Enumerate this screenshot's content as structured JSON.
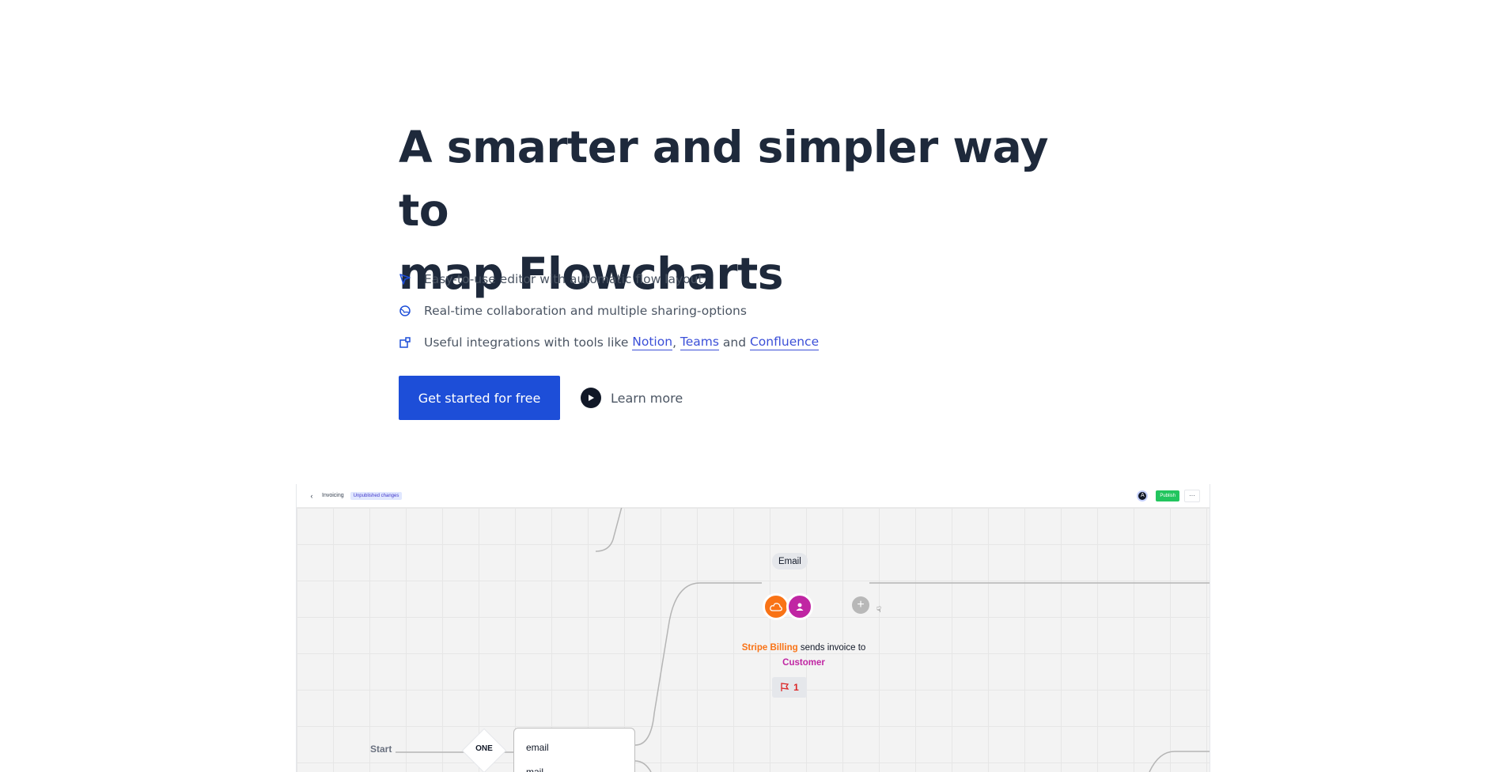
{
  "hero": {
    "title_line1": "A smarter and simpler way to",
    "title_line2": "map Flowcharts"
  },
  "features": [
    {
      "icon": "cursor-arrow-icon",
      "text": "Easy-to-use editor with automatic flow layout"
    },
    {
      "icon": "globe-icon",
      "text": "Real-time collaboration and multiple sharing-options"
    },
    {
      "icon": "integrations-icon",
      "text_prefix": "Useful integrations with tools like ",
      "links": [
        "Notion",
        "Teams",
        "Confluence"
      ],
      "sep1": ", ",
      "sep2": " and "
    }
  ],
  "cta": {
    "primary_label": "Get started for free",
    "secondary_label": "Learn more"
  },
  "app": {
    "doc_name": "Invoicing",
    "status_badge": "Unpublished changes",
    "avatar_letter": "A",
    "publish_label": "Publish",
    "more_label": "···",
    "node": {
      "channel": "Email",
      "source": "Stripe Billing",
      "action": " sends invoice to",
      "target": "Customer",
      "flag_count": "1"
    },
    "start_label": "Start",
    "decision_label": "ONE",
    "options": [
      "email",
      "mail"
    ]
  },
  "colors": {
    "primary": "#1d4ed8",
    "link": "#3b4fd8",
    "source_orange": "#f97316",
    "target_magenta": "#c026a3",
    "publish_green": "#22c55e"
  }
}
